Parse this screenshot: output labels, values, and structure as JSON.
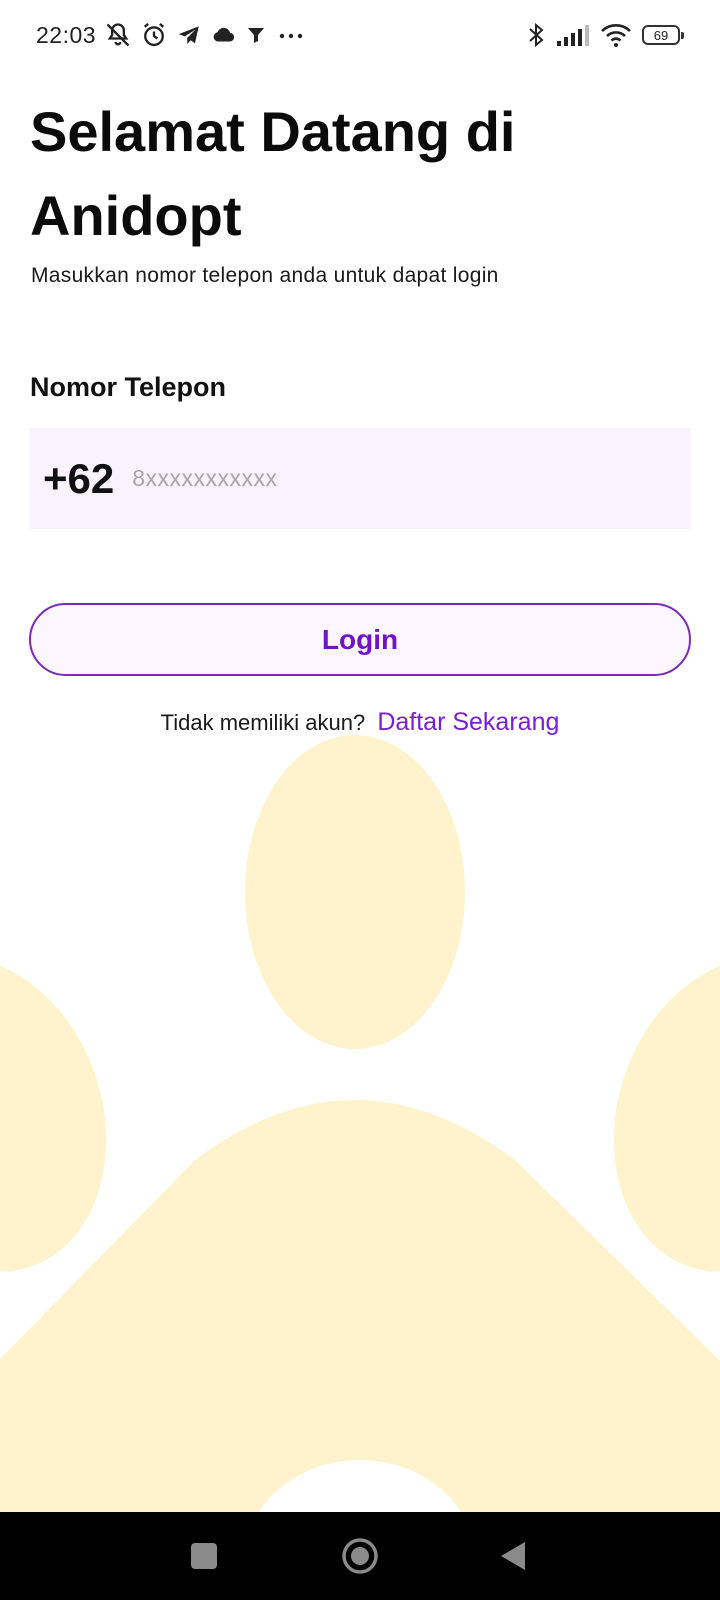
{
  "status_bar": {
    "time": "22:03",
    "battery_level": "69",
    "left_icons": [
      "notifications-off-icon",
      "alarm-icon",
      "telegram-icon",
      "cloud-icon",
      "filter-icon",
      "more-dots-icon"
    ],
    "right_icons": [
      "bluetooth-icon",
      "signal-icon",
      "wifi-icon",
      "battery-icon"
    ]
  },
  "header": {
    "title": "Selamat Datang di Anidopt",
    "subtitle": "Masukkan nomor telepon anda untuk dapat login"
  },
  "form": {
    "phone_label": "Nomor Telepon",
    "country_code": "+62",
    "phone_value": "",
    "phone_placeholder": "8xxxxxxxxxxx",
    "login_label": "Login"
  },
  "register": {
    "prompt": "Tidak memiliki akun?",
    "link_label": "Daftar Sekarang"
  },
  "nav_bar": {
    "buttons": [
      "recents-square-icon",
      "home-circle-icon",
      "back-triangle-icon"
    ]
  },
  "colors": {
    "accent": "#7a1fcf",
    "paw": "#fef3cc",
    "field_bg": "#faf3fd"
  }
}
